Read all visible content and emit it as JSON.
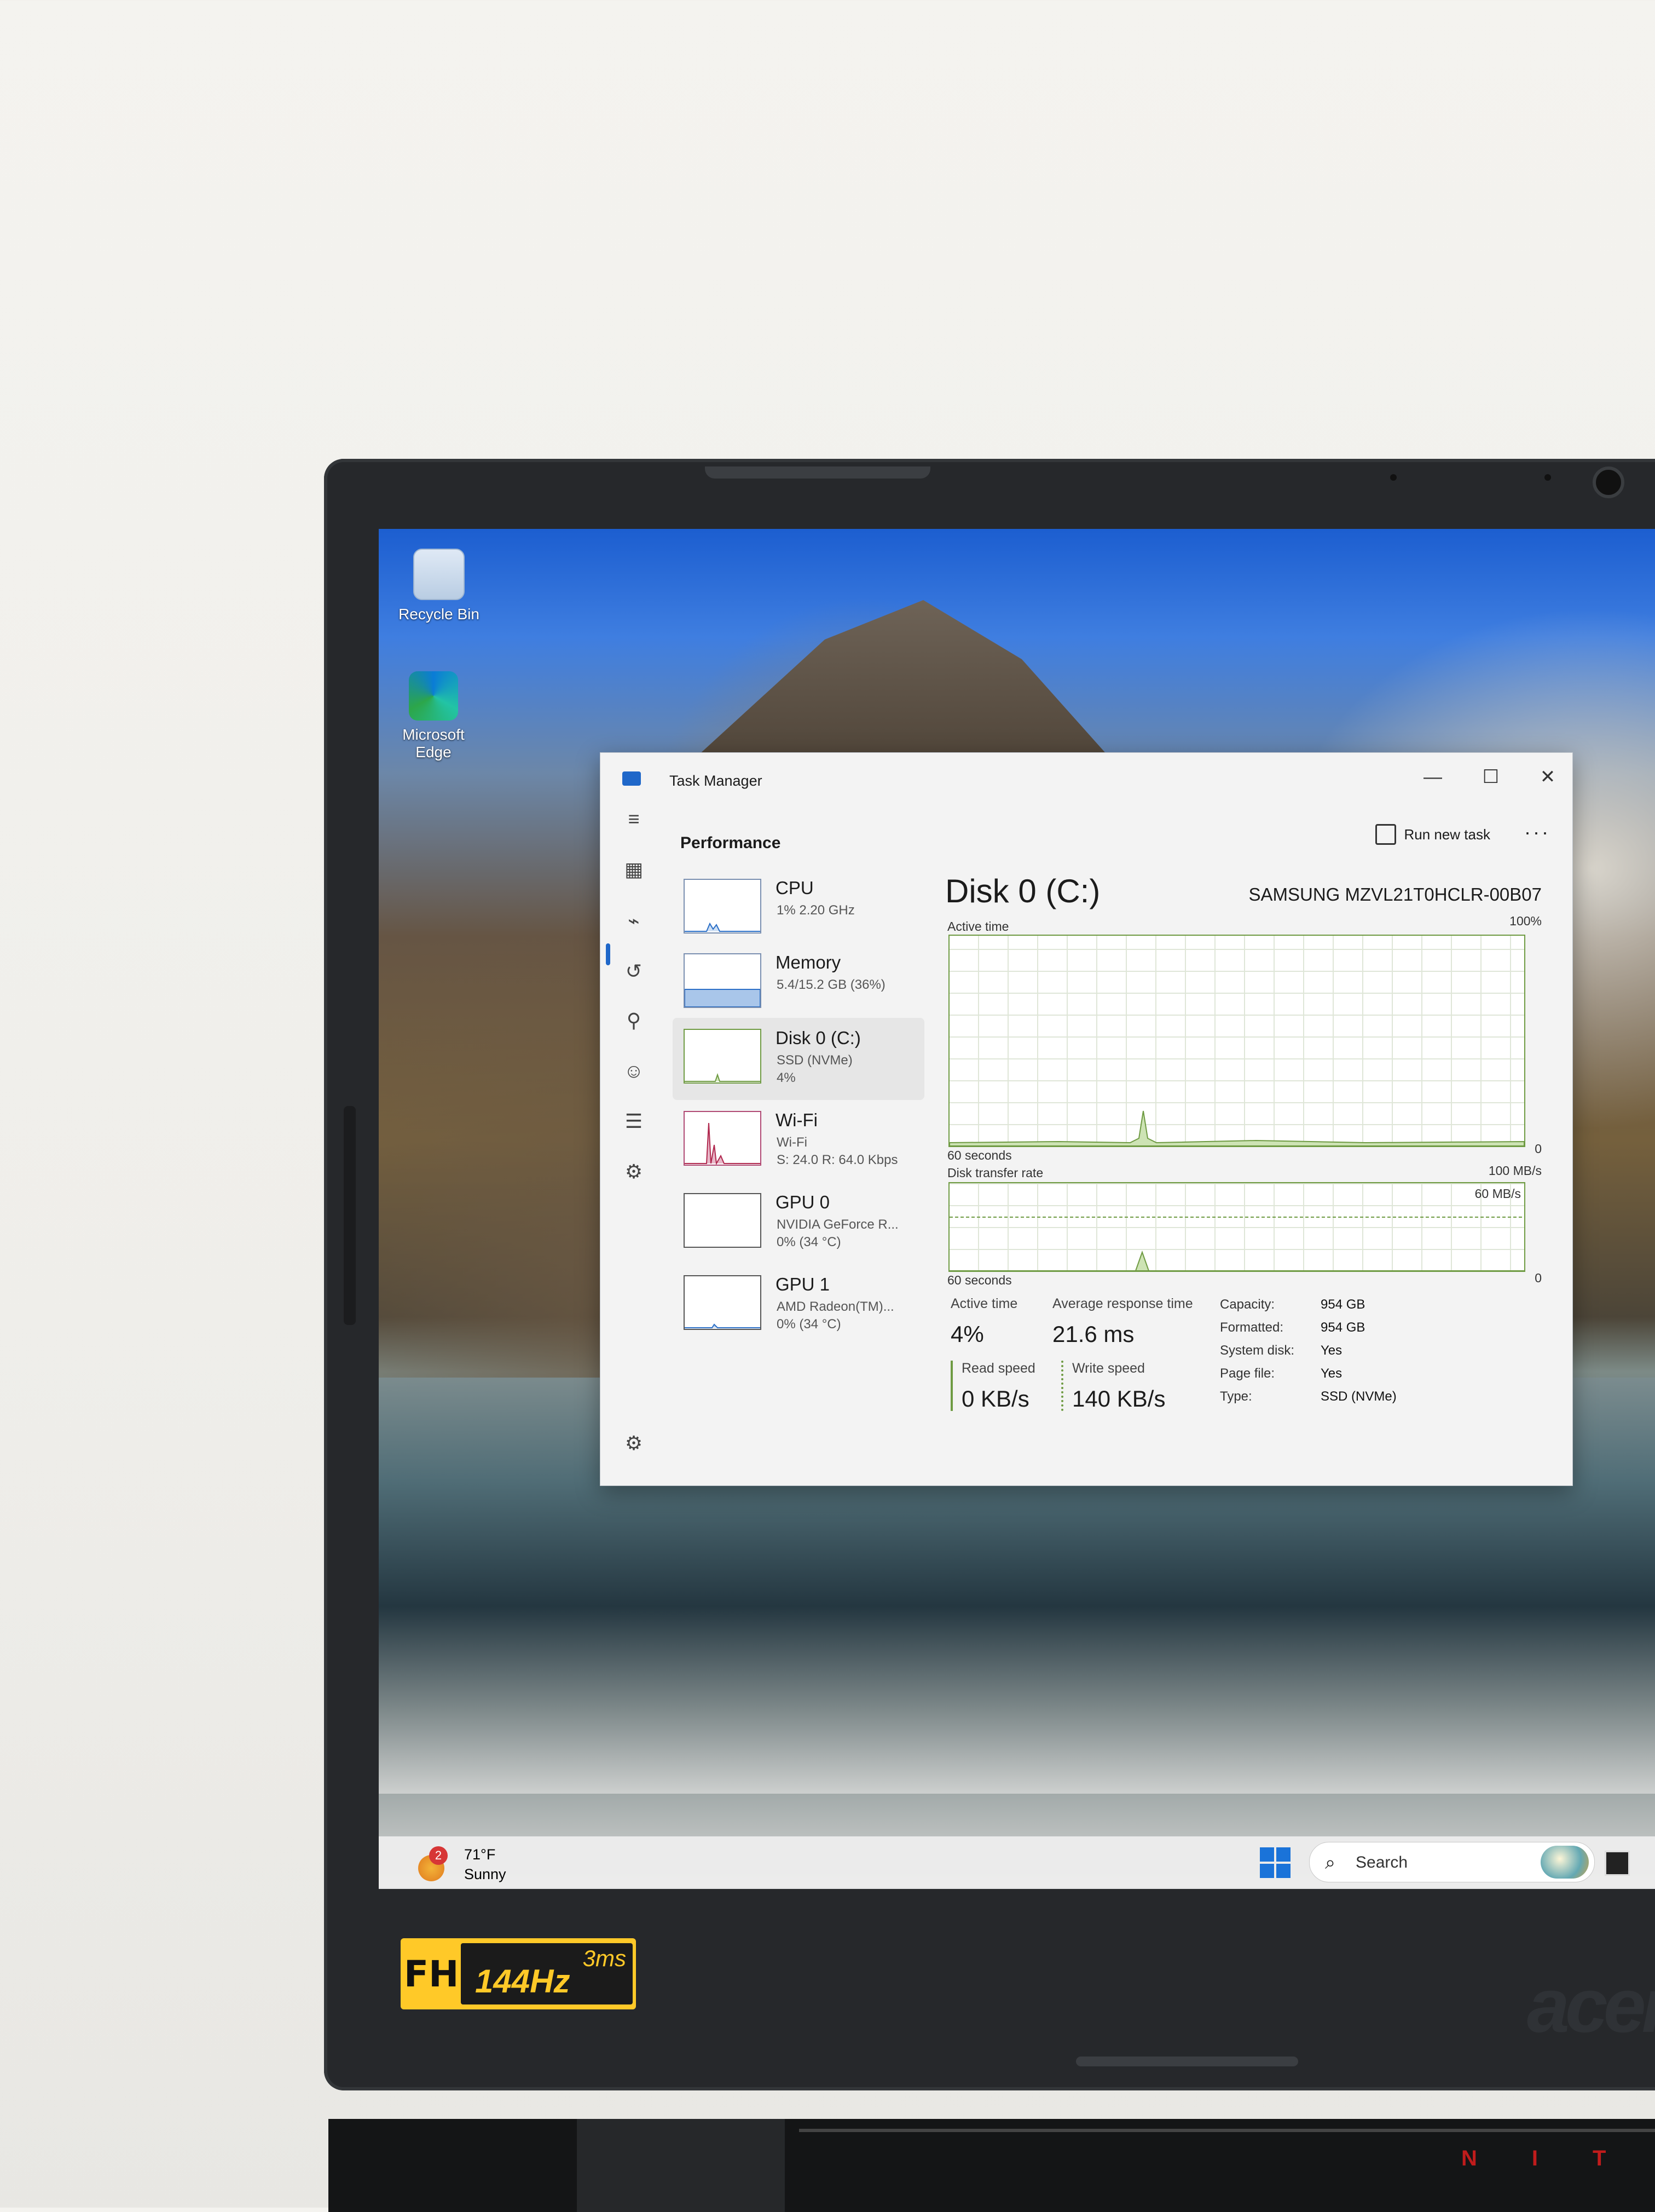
{
  "desktop": {
    "icons": [
      {
        "label": "Recycle Bin"
      },
      {
        "label": "Microsoft Edge"
      }
    ]
  },
  "task_manager": {
    "window_title": "Task Manager",
    "window_buttons": {
      "minimize": "—",
      "maximize": "☐",
      "close": "✕"
    },
    "section_title": "Performance",
    "run_new_task": "Run new task",
    "more": "···",
    "sidebar": [
      {
        "name": "CPU",
        "line2": "1% 2.20 GHz",
        "line3": ""
      },
      {
        "name": "Memory",
        "line2": "5.4/15.2 GB (36%)",
        "line3": ""
      },
      {
        "name": "Disk 0 (C:)",
        "line2": "SSD (NVMe)",
        "line3": "4%"
      },
      {
        "name": "Wi-Fi",
        "line2": "Wi-Fi",
        "line3": "S: 24.0 R: 64.0 Kbps"
      },
      {
        "name": "GPU 0",
        "line2": "NVIDIA GeForce R...",
        "line3": "0% (34 °C)"
      },
      {
        "name": "GPU 1",
        "line2": "AMD Radeon(TM)...",
        "line3": "0% (34 °C)"
      }
    ],
    "detail": {
      "title": "Disk 0 (C:)",
      "model": "SAMSUNG MZVL21T0HCLR-00B07",
      "graph1": {
        "label": "Active time",
        "max": "100%",
        "xlabel": "60 seconds",
        "min": "0"
      },
      "graph2": {
        "label": "Disk transfer rate",
        "max": "100 MB/s",
        "mid": "60 MB/s",
        "xlabel": "60 seconds",
        "min": "0"
      },
      "stats": {
        "active_time_label": "Active time",
        "active_time": "4%",
        "avg_resp_label": "Average response time",
        "avg_resp": "21.6 ms",
        "read_label": "Read speed",
        "read": "0 KB/s",
        "write_label": "Write speed",
        "write": "140 KB/s"
      },
      "props": [
        {
          "k": "Capacity:",
          "v": "954 GB"
        },
        {
          "k": "Formatted:",
          "v": "954 GB"
        },
        {
          "k": "System disk:",
          "v": "Yes"
        },
        {
          "k": "Page file:",
          "v": "Yes"
        },
        {
          "k": "Type:",
          "v": "SSD (NVMe)"
        }
      ]
    }
  },
  "taskbar": {
    "weather_badge": "2",
    "weather_temp": "71°F",
    "weather_desc": "Sunny",
    "search_placeholder": "Search"
  },
  "hardware": {
    "badge_fhd": "FHD",
    "badge_rate": "144Hz",
    "badge_ms": "3ms",
    "brand": "acer",
    "nitro": "NIT"
  }
}
